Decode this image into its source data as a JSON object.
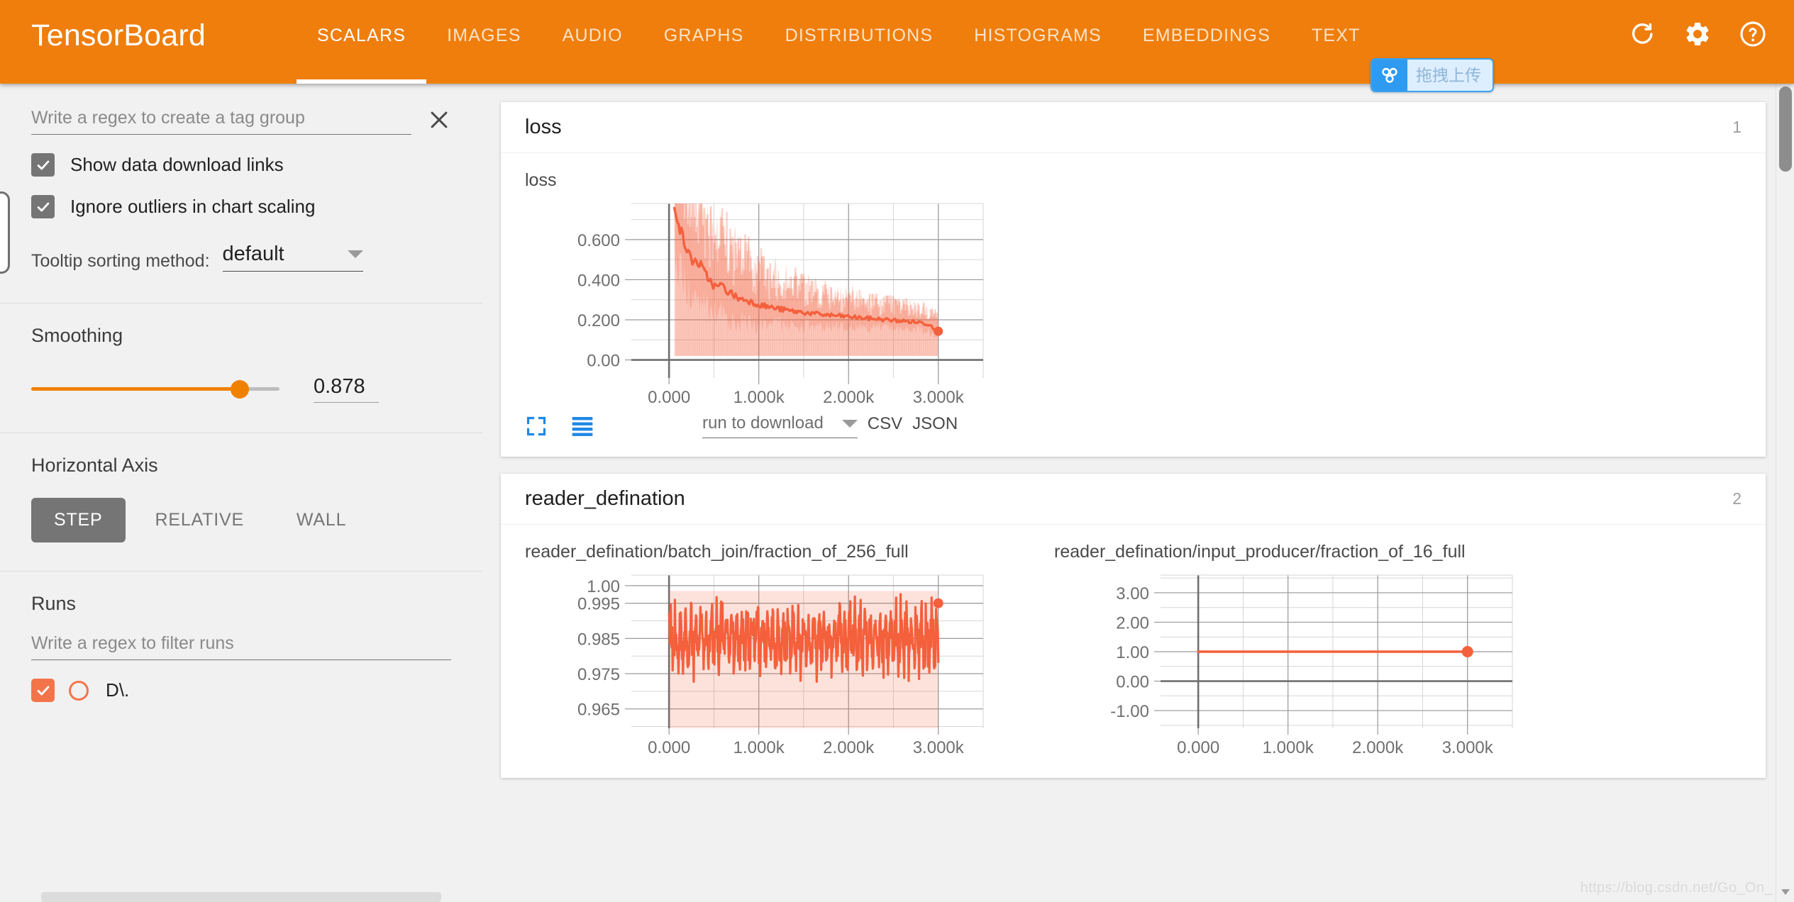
{
  "app": {
    "brand": "TensorBoard",
    "accent_color": "#ef7e0d",
    "series_color": "#f4603c"
  },
  "nav": {
    "tabs": [
      {
        "label": "SCALARS",
        "active": true
      },
      {
        "label": "IMAGES",
        "active": false
      },
      {
        "label": "AUDIO",
        "active": false
      },
      {
        "label": "GRAPHS",
        "active": false
      },
      {
        "label": "DISTRIBUTIONS",
        "active": false
      },
      {
        "label": "HISTOGRAMS",
        "active": false
      },
      {
        "label": "EMBEDDINGS",
        "active": false
      },
      {
        "label": "TEXT",
        "active": false
      }
    ],
    "icons": [
      "refresh-icon",
      "gear-icon",
      "help-icon"
    ]
  },
  "upload_badge": {
    "text": "拖拽上传",
    "icon": "baidu-netdisk-icon"
  },
  "sidebar": {
    "tag_regex": {
      "placeholder": "Write a regex to create a tag group",
      "value": ""
    },
    "clear_label": "×",
    "checkboxes": [
      {
        "label": "Show data download links",
        "checked": true
      },
      {
        "label": "Ignore outliers in chart scaling",
        "checked": true
      }
    ],
    "tooltip_sorting": {
      "label": "Tooltip sorting method:",
      "value": "default"
    },
    "smoothing": {
      "title": "Smoothing",
      "value": "0.878",
      "percent": 84
    },
    "horizontal_axis": {
      "title": "Horizontal Axis",
      "options": [
        {
          "label": "STEP",
          "selected": true
        },
        {
          "label": "RELATIVE",
          "selected": false
        },
        {
          "label": "WALL",
          "selected": false
        }
      ]
    },
    "runs": {
      "title": "Runs",
      "filter_placeholder": "Write a regex to filter runs",
      "items": [
        {
          "name": "D\\.",
          "checked": true,
          "color": "#f4744a"
        }
      ]
    }
  },
  "main": {
    "cards": [
      {
        "title": "loss",
        "count": "1",
        "charts": [
          {
            "title": "loss",
            "tools": [
              "expand-icon",
              "data-series-icon"
            ],
            "download": {
              "placeholder": "run to download",
              "csv": "CSV",
              "json": "JSON"
            }
          }
        ]
      },
      {
        "title": "reader_defination",
        "count": "2",
        "charts": [
          {
            "title": "reader_defination/batch_join/fraction_of_256_full"
          },
          {
            "title": "reader_defination/input_producer/fraction_of_16_full"
          }
        ]
      }
    ]
  },
  "watermark": "https://blog.csdn.net/Go_On_",
  "chart_data": [
    {
      "type": "line",
      "title": "loss",
      "xlabel": "",
      "ylabel": "",
      "xtick_labels": [
        "0.000",
        "1.000k",
        "2.000k",
        "3.000k"
      ],
      "xticks": [
        0,
        1000,
        2000,
        3000
      ],
      "ytick_labels": [
        "0.00",
        "0.200",
        "0.400",
        "0.600"
      ],
      "yticks": [
        0.0,
        0.2,
        0.4,
        0.6
      ],
      "xlim": [
        -420,
        3500
      ],
      "ylim": [
        -0.09,
        0.78
      ],
      "grid": true,
      "legend": false,
      "series": [
        {
          "name": "D\\. (smoothed)",
          "x": [
            60,
            90,
            120,
            160,
            200,
            250,
            300,
            350,
            400,
            460,
            520,
            580,
            640,
            700,
            780,
            860,
            940,
            1020,
            1100,
            1180,
            1280,
            1380,
            1480,
            1580,
            1700,
            1820,
            1940,
            2060,
            2180,
            2300,
            2420,
            2540,
            2660,
            2780,
            2900,
            3000
          ],
          "values": [
            0.78,
            0.72,
            0.66,
            0.6,
            0.545,
            0.5,
            0.49,
            0.475,
            0.43,
            0.395,
            0.36,
            0.375,
            0.345,
            0.33,
            0.305,
            0.3,
            0.285,
            0.275,
            0.265,
            0.258,
            0.25,
            0.243,
            0.238,
            0.232,
            0.226,
            0.222,
            0.218,
            0.213,
            0.208,
            0.205,
            0.2,
            0.196,
            0.192,
            0.188,
            0.178,
            0.143
          ]
        },
        {
          "name": "D\\. (raw band)",
          "band_low": 0.0,
          "band_high": 0.78
        }
      ]
    },
    {
      "type": "line",
      "title": "reader_defination/batch_join/fraction_of_256_full",
      "xtick_labels": [
        "0.000",
        "1.000k",
        "2.000k",
        "3.000k"
      ],
      "xticks": [
        0,
        1000,
        2000,
        3000
      ],
      "ytick_labels": [
        "0.965",
        "0.975",
        "0.985",
        "0.995",
        "1.00"
      ],
      "yticks": [
        0.965,
        0.975,
        0.985,
        0.995,
        1.0
      ],
      "xlim": [
        -420,
        3500
      ],
      "ylim": [
        0.9595,
        1.003
      ],
      "grid": true,
      "legend": false,
      "series": [
        {
          "name": "D\\.",
          "last_value": 0.995,
          "min": 0.96,
          "max": 0.9985,
          "mean": 0.985
        }
      ]
    },
    {
      "type": "line",
      "title": "reader_defination/input_producer/fraction_of_16_full",
      "xtick_labels": [
        "0.000",
        "1.000k",
        "2.000k",
        "3.000k"
      ],
      "xticks": [
        0,
        1000,
        2000,
        3000
      ],
      "ytick_labels": [
        "-1.00",
        "0.00",
        "1.00",
        "2.00",
        "3.00"
      ],
      "yticks": [
        -1,
        0,
        1,
        2,
        3
      ],
      "xlim": [
        -420,
        3500
      ],
      "ylim": [
        -1.6,
        3.6
      ],
      "grid": true,
      "legend": false,
      "series": [
        {
          "name": "D\\.",
          "x": [
            0,
            3000
          ],
          "values": [
            1.0,
            1.0
          ],
          "last_value": 1.0
        }
      ]
    }
  ]
}
